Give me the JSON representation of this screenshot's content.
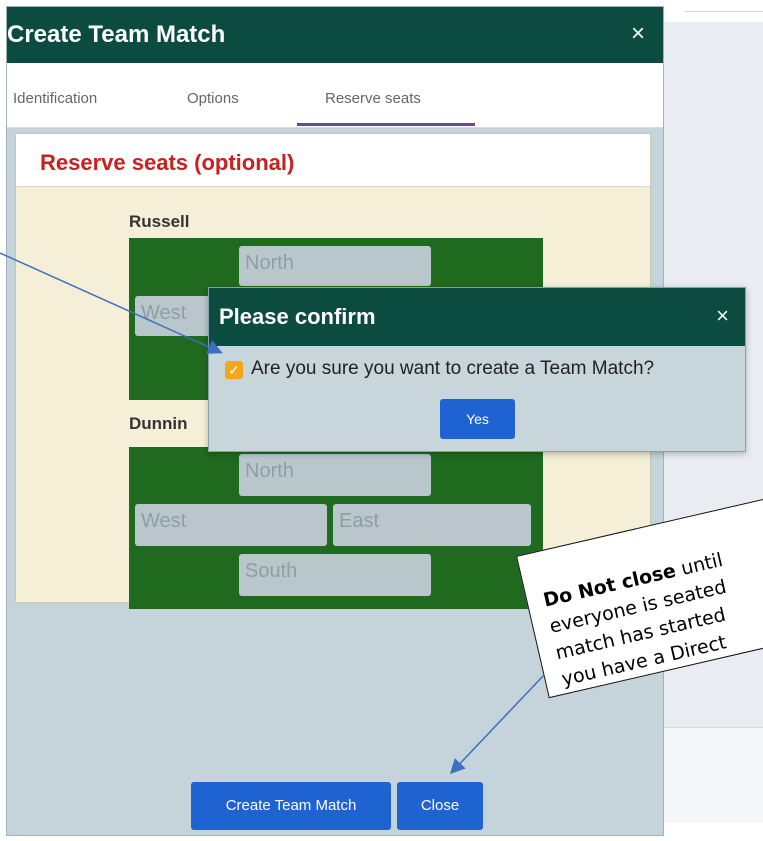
{
  "dialog": {
    "title": "Create Team Match",
    "close_glyph": "×",
    "tabs": [
      {
        "label": "Identification"
      },
      {
        "label": "Options"
      },
      {
        "label": "Reserve seats",
        "active": true
      }
    ]
  },
  "reserve": {
    "title": "Reserve seats (optional)",
    "teams": [
      {
        "name": "Russell",
        "seats": {
          "north": "North",
          "west": "West"
        }
      },
      {
        "name": "Dunnin",
        "seats": {
          "north": "North",
          "west": "West",
          "east": "East",
          "south": "South"
        }
      }
    ]
  },
  "confirm": {
    "title": "Please confirm",
    "close_glyph": "×",
    "checked": true,
    "message": "Are you sure you want to create a Team Match?",
    "yes_label": "Yes"
  },
  "footer": {
    "create_label": "Create Team Match",
    "close_label": "Close"
  },
  "annotation": {
    "line1_bold": "Do Not close",
    "line1_rest": " until",
    "line2": "everyone is seated",
    "line3": "match has started",
    "line4": "you have a Direct"
  },
  "colors": {
    "header": "#0b4b40",
    "primary_button": "#1f63d2",
    "reserve_title": "#c92020",
    "table_green": "#1f6a1f",
    "checkbox": "#f0a81a"
  }
}
